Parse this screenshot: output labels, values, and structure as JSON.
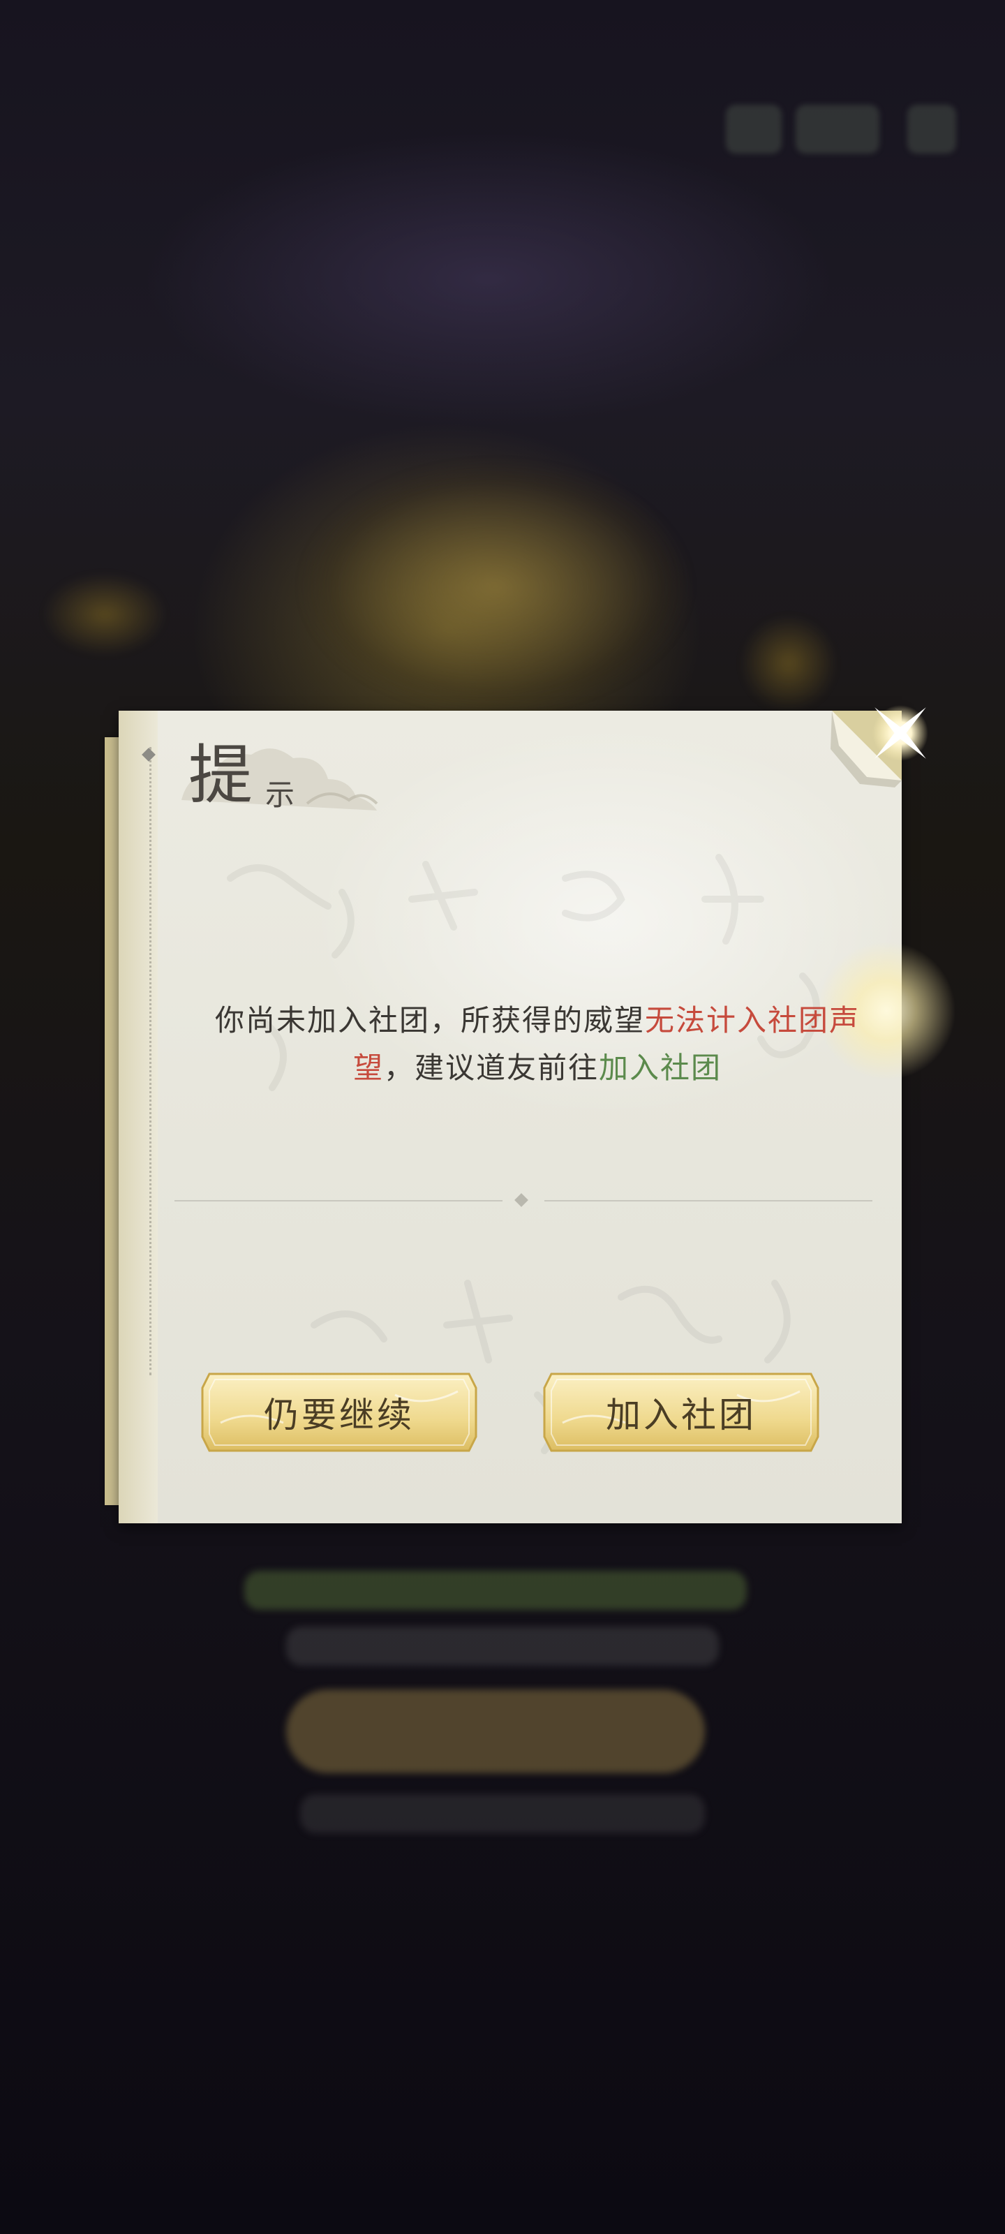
{
  "dialog": {
    "title": "提",
    "title_suffix": "示",
    "message": {
      "part1": "你尚未加入社团，所获得的威望",
      "highlight1": "无法计入社团声望",
      "part2": "，建议道友前往",
      "highlight2": "加入社团"
    },
    "buttons": {
      "continue_label": "仍要继续",
      "join_label": "加入社团"
    },
    "close_icon": "close-sparkle-icon"
  },
  "colors": {
    "highlight_red": "#c64a3c",
    "highlight_green": "#5b8a4c",
    "paper": "#e8e7dd",
    "button_gold": "#f1dc9a"
  }
}
